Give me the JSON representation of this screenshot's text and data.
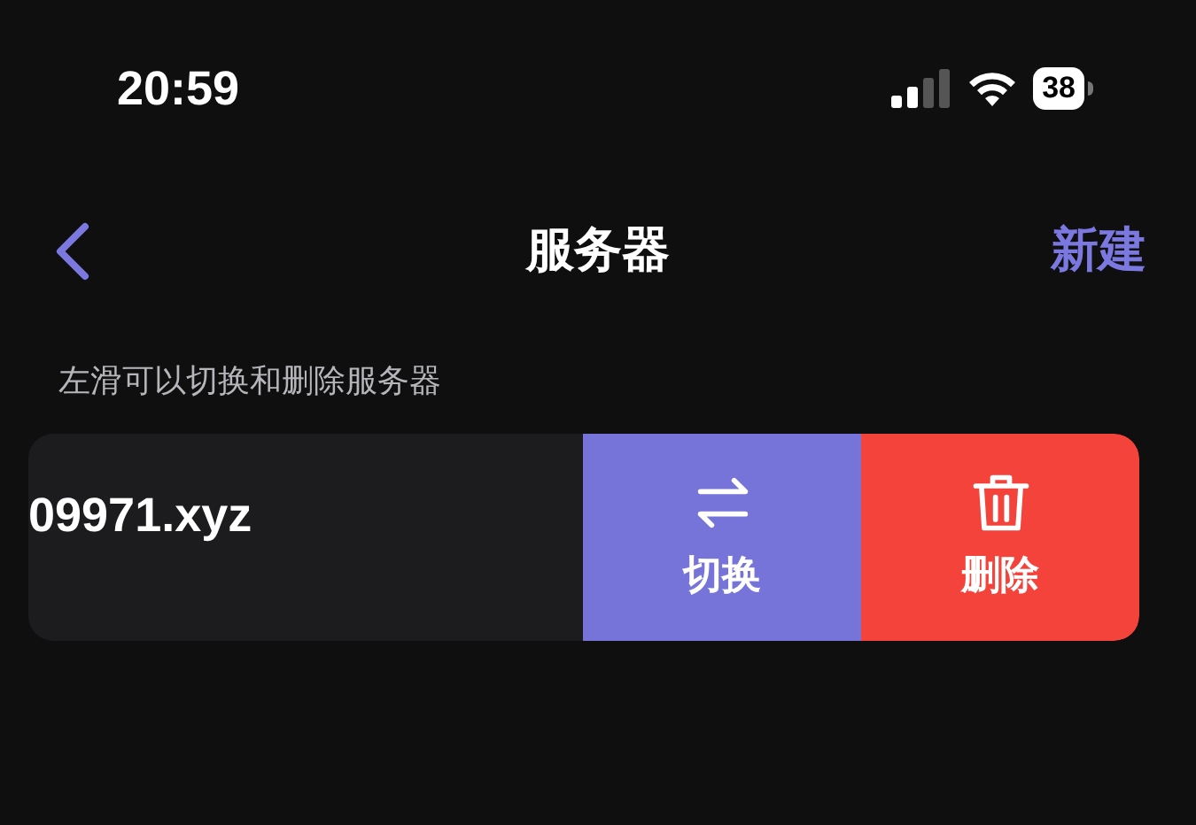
{
  "status_bar": {
    "time": "20:59",
    "battery": "38"
  },
  "nav": {
    "title": "服务器",
    "action": "新建"
  },
  "hint": "左滑可以切换和删除服务器",
  "server": {
    "name": "09971.xyz"
  },
  "swipe_actions": [
    {
      "kind": "switch",
      "label": "切换"
    },
    {
      "kind": "delete",
      "label": "删除"
    }
  ]
}
